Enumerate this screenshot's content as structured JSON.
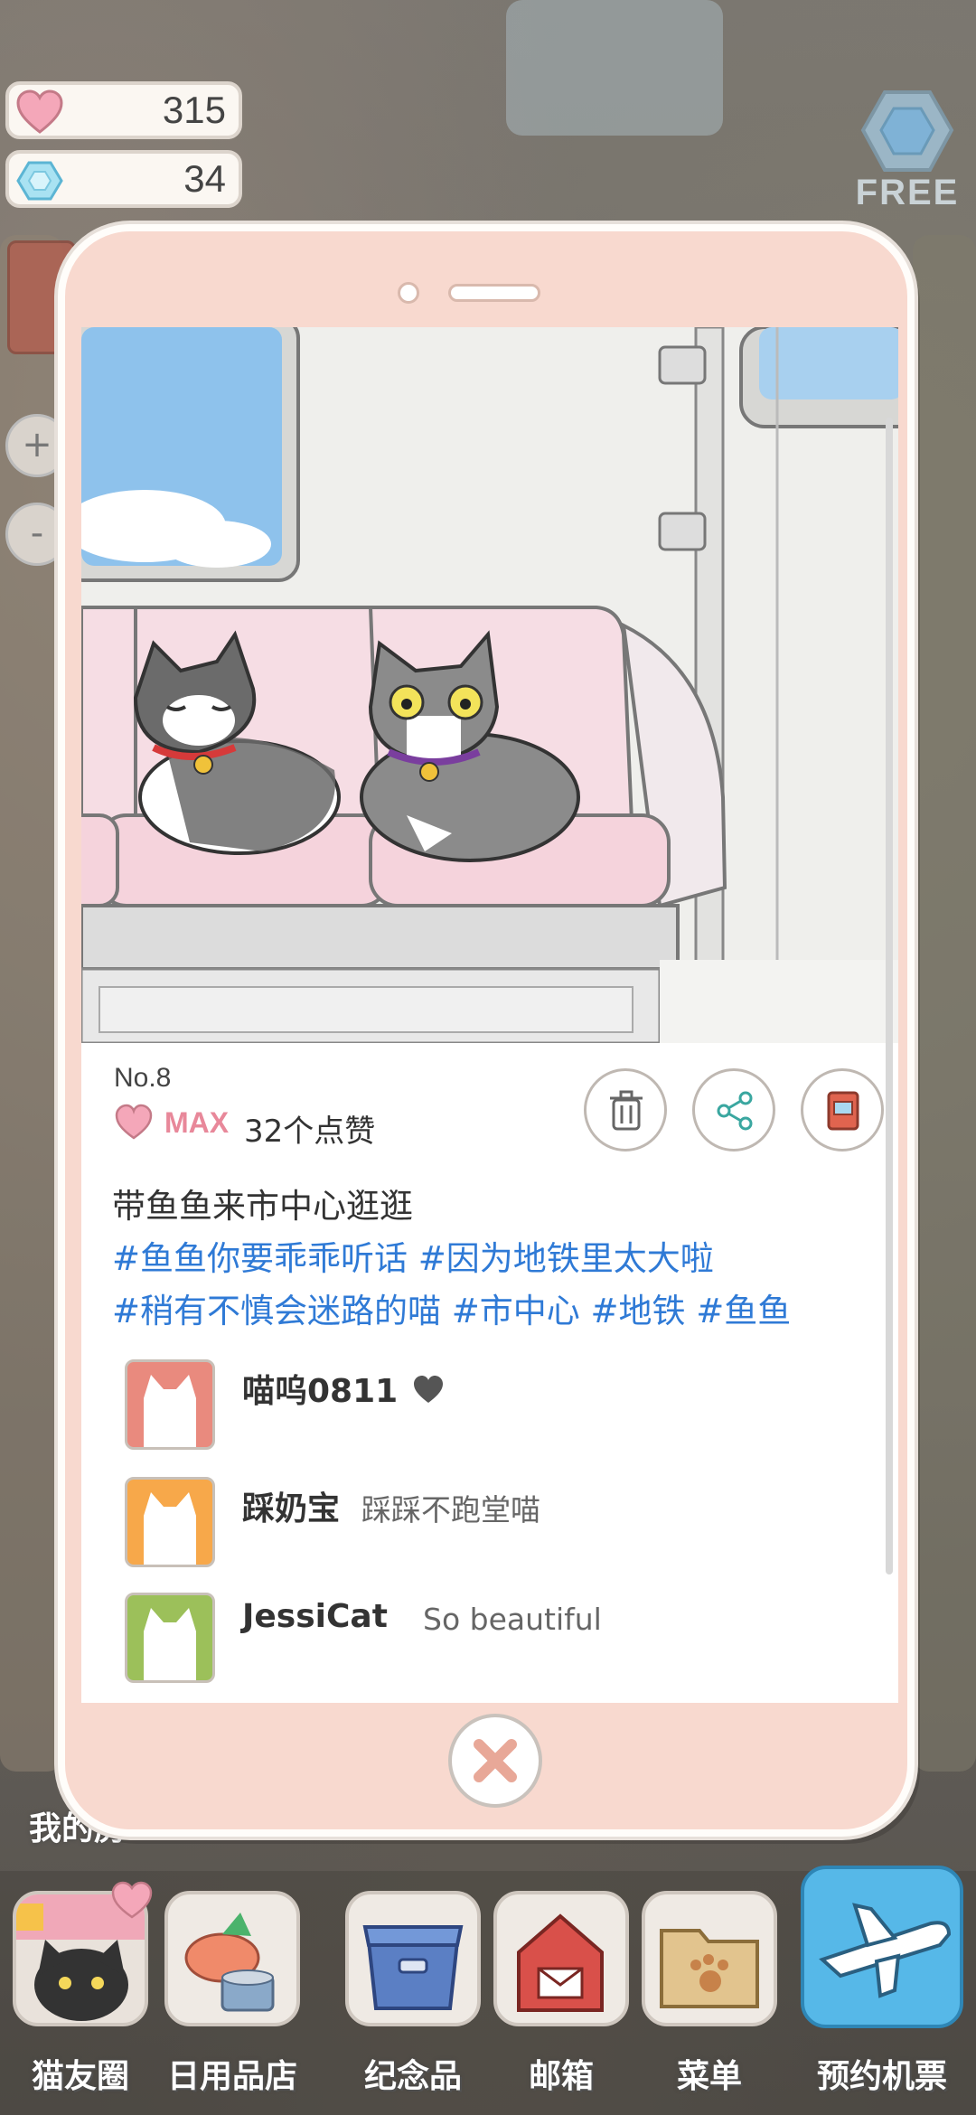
{
  "status": {
    "hearts": "315",
    "gems": "34",
    "free_label": "FREE"
  },
  "post": {
    "number": "No.8",
    "max_label": "MAX",
    "likes": "32个点赞",
    "caption": "带鱼鱼来市中心逛逛",
    "tags_line1": "#鱼鱼你要乖乖听话 #因为地铁里太大啦",
    "tags_line2": "#稍有不慎会迷路的喵 #市中心 #地铁 #鱼鱼"
  },
  "comments": [
    {
      "name": "喵呜0811",
      "text": "",
      "avatar_color": "#e98a7e"
    },
    {
      "name": "踩奶宝",
      "text": "踩踩不跑堂喵",
      "avatar_color": "#f7a84a"
    },
    {
      "name": "JessiCat",
      "text": "So beautiful",
      "avatar_color": "#9cc05a"
    }
  ],
  "partial_label": "我的房",
  "nav": [
    {
      "label": "猫友圈",
      "icon": "cat-friends-icon"
    },
    {
      "label": "日用品店",
      "icon": "shop-icon"
    },
    {
      "label": "纪念品",
      "icon": "souvenir-box-icon"
    },
    {
      "label": "邮箱",
      "icon": "mailbox-icon"
    },
    {
      "label": "菜单",
      "icon": "menu-folder-icon"
    },
    {
      "label": "预约机票",
      "icon": "airplane-icon"
    }
  ],
  "colors": {
    "tag_blue": "#2f7ad6",
    "phone_frame": "#f8d9cf",
    "heart_pink": "#f4a7b9"
  }
}
